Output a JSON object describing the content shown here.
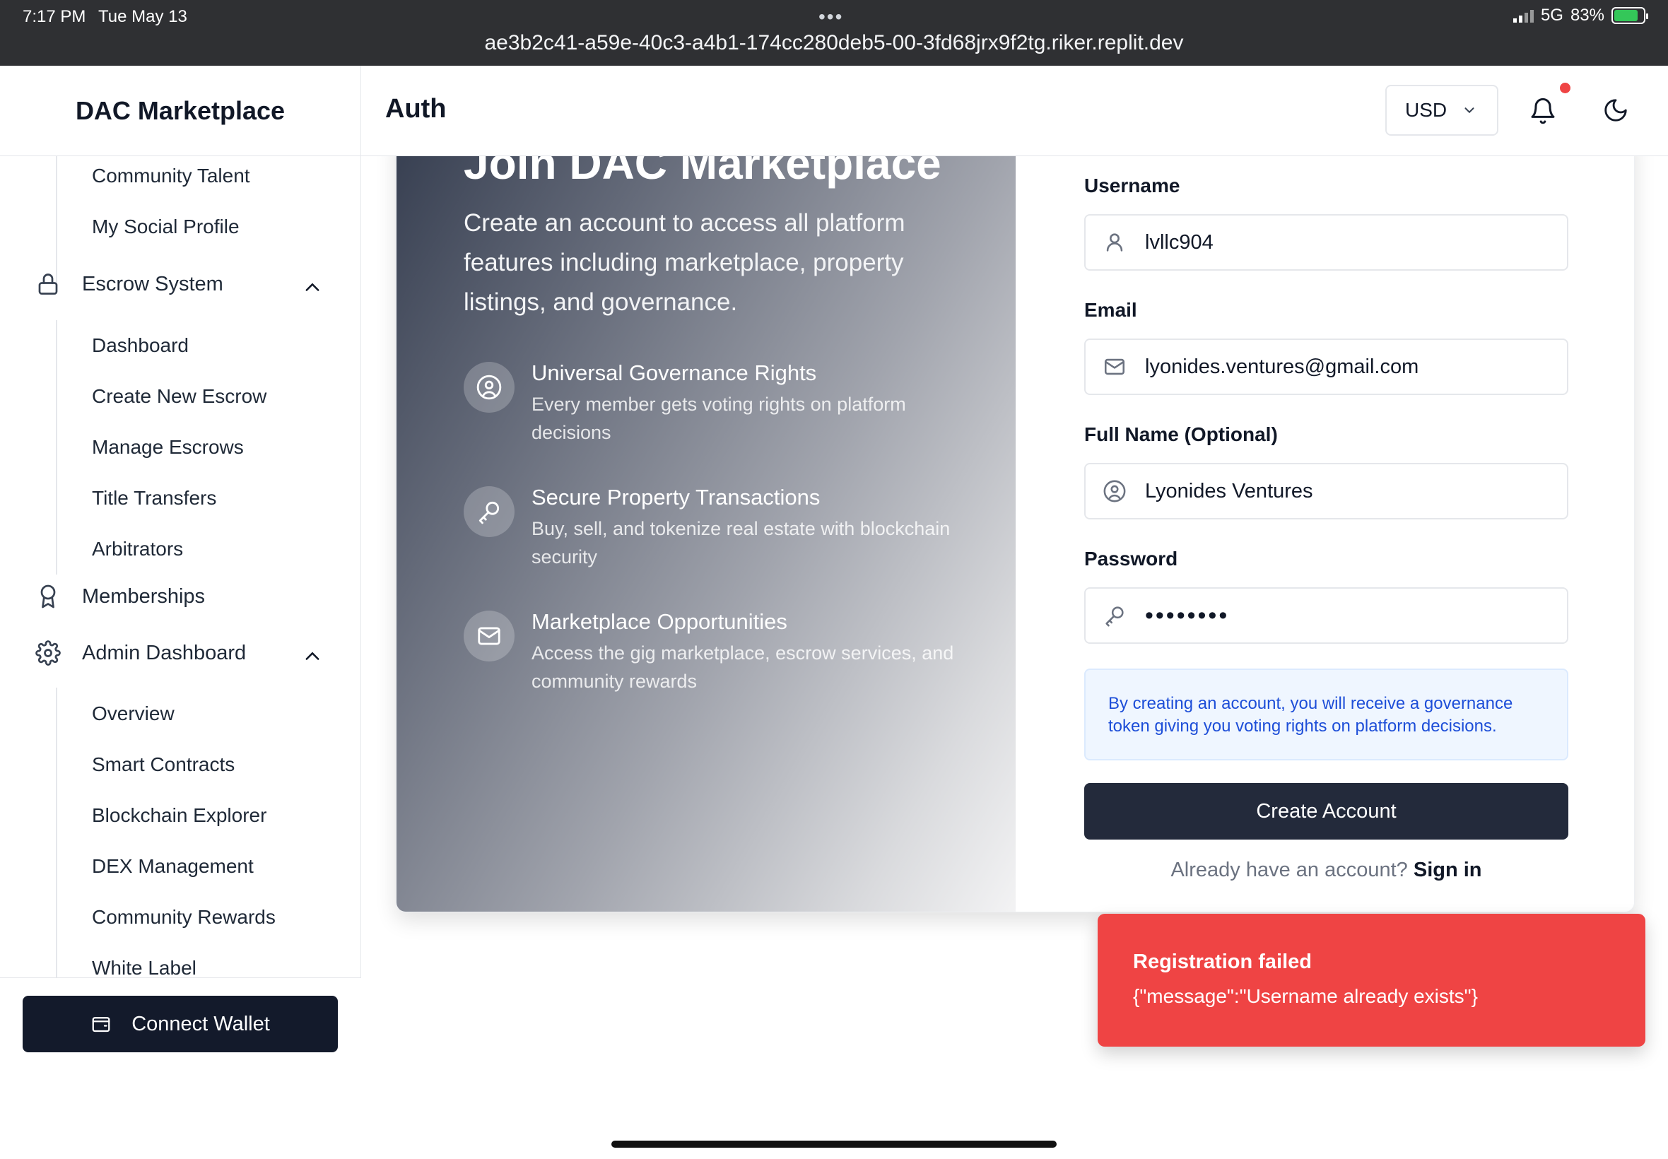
{
  "status_bar": {
    "time": "7:17 PM",
    "date": "Tue May 13",
    "url": "ae3b2c41-a59e-40c3-a4b1-174cc280deb5-00-3fd68jrx9f2tg.riker.replit.dev",
    "network": "5G",
    "battery": "83%"
  },
  "sidebar": {
    "brand": "DAC Marketplace",
    "community_items": [
      "Community Talent",
      "My Social Profile"
    ],
    "escrow_section": {
      "label": "Escrow System",
      "icon": "lock-icon",
      "items": [
        "Dashboard",
        "Create New Escrow",
        "Manage Escrows",
        "Title Transfers",
        "Arbitrators"
      ]
    },
    "memberships": {
      "label": "Memberships",
      "icon": "award-icon"
    },
    "admin_section": {
      "label": "Admin Dashboard",
      "icon": "gear-icon",
      "items": [
        "Overview",
        "Smart Contracts",
        "Blockchain Explorer",
        "DEX Management",
        "Community Rewards",
        "White Label"
      ]
    },
    "connect_wallet_label": "Connect Wallet"
  },
  "header": {
    "title": "Auth",
    "currency": "USD"
  },
  "hero": {
    "title": "Join DAC Marketplace",
    "subtitle": "Create an account to access all platform features including marketplace, property listings, and governance.",
    "features": [
      {
        "icon": "user-circle-icon",
        "title": "Universal Governance Rights",
        "desc": "Every member gets voting rights on platform decisions"
      },
      {
        "icon": "key-icon",
        "title": "Secure Property Transactions",
        "desc": "Buy, sell, and tokenize real estate with blockchain security"
      },
      {
        "icon": "mail-icon",
        "title": "Marketplace Opportunities",
        "desc": "Access the gig marketplace, escrow services, and community rewards"
      }
    ]
  },
  "form": {
    "username": {
      "label": "Username",
      "value": "lvllc904"
    },
    "email": {
      "label": "Email",
      "value": "lyonides.ventures@gmail.com"
    },
    "full_name": {
      "label": "Full Name (Optional)",
      "value": "Lyonides Ventures"
    },
    "password": {
      "label": "Password",
      "value": "••••••••"
    },
    "notice": "By creating an account, you will receive a governance token giving you voting rights on platform decisions.",
    "submit_label": "Create Account",
    "signin_prompt": "Already have an account?",
    "signin_link": "Sign in"
  },
  "toast": {
    "title": "Registration failed",
    "message": "{\"message\":\"Username already exists\"}",
    "color": "#ef4444"
  },
  "colors": {
    "primary_button": "#232a3b",
    "wallet_button": "#131a2b",
    "notice_text": "#1d4ed8",
    "notification_dot": "#ef4444"
  }
}
